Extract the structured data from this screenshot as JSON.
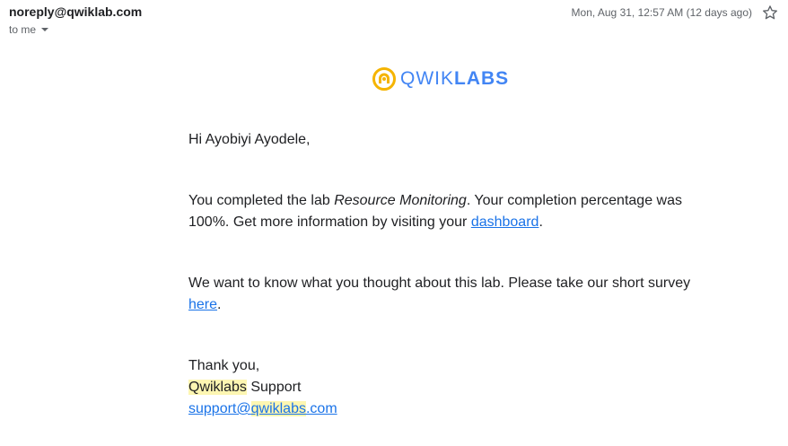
{
  "header": {
    "sender": "noreply@qwiklab.com",
    "recipient": "to me",
    "date": "Mon, Aug 31, 12:57 AM (12 days ago)",
    "star_icon": "star-outline-icon"
  },
  "logo": {
    "mark_icon": "qwiklabs-logo-icon",
    "text_light": "QWIK",
    "text_bold": "LABS",
    "colors": {
      "mark": "#f5b400",
      "text": "#4285f4"
    }
  },
  "email": {
    "greeting": "Hi Ayobiyi Ayodele,",
    "para1_before": "You completed the lab ",
    "lab_name": "Resource Monitoring",
    "para1_middle": ". Your completion percentage was 100%. Get more information by visiting your ",
    "dashboard_link": "dashboard",
    "para1_end": ".",
    "para2_before": "We want to know what you thought about this lab. Please take our short survey ",
    "survey_link": "here",
    "para2_end": ".",
    "thanks": "Thank you,",
    "signature_brand": "Qwiklabs",
    "signature_rest": " Support",
    "support_email_pre": "support@",
    "support_email_brand": "qwiklabs",
    "support_email_post": ".com"
  },
  "colors": {
    "link": "#1a73e8",
    "highlight": "#fdf6b2"
  }
}
